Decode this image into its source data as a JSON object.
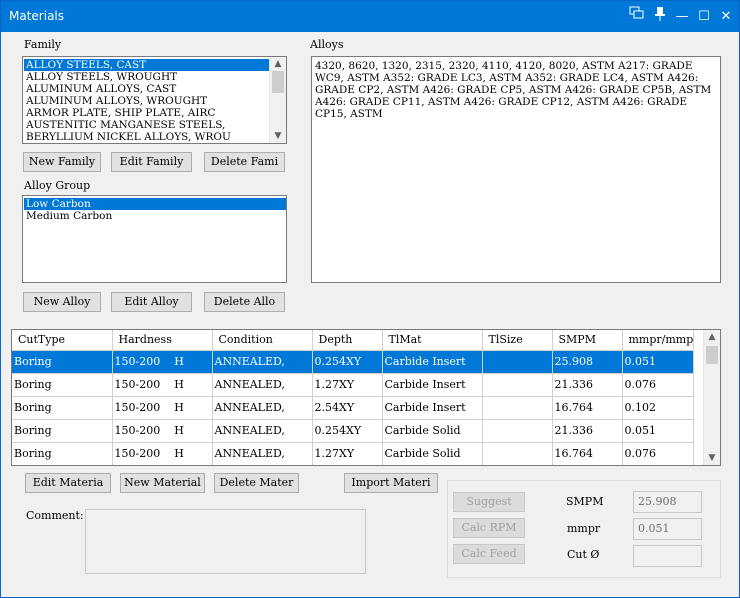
{
  "window": {
    "title": "Materials"
  },
  "family": {
    "label": "Family",
    "items": [
      {
        "label": "ALLOY STEELS, CAST",
        "selected": true
      },
      {
        "label": "ALLOY STEELS, WROUGHT",
        "selected": false
      },
      {
        "label": "ALUMINUM ALLOYS, CAST",
        "selected": false
      },
      {
        "label": "ALUMINUM ALLOYS, WROUGHT",
        "selected": false
      },
      {
        "label": "ARMOR PLATE, SHIP PLATE, AIRC",
        "selected": false
      },
      {
        "label": "AUSTENITIC MANGANESE STEELS,",
        "selected": false
      },
      {
        "label": "BERYLLIUM NICKEL ALLOYS, WROU",
        "selected": false
      }
    ],
    "buttons": {
      "new": "New Family",
      "edit": "Edit Family",
      "delete": "Delete Fami"
    }
  },
  "alloy_group": {
    "label": "Alloy Group",
    "items": [
      {
        "label": "Low Carbon",
        "selected": true
      },
      {
        "label": "Medium Carbon",
        "selected": false
      }
    ],
    "buttons": {
      "new": "New Alloy",
      "edit": "Edit Alloy",
      "delete": "Delete Allo"
    }
  },
  "alloys": {
    "label": "Alloys",
    "text": "4320, 8620, 1320, 2315, 2320, 4110, 4120, 8020, ASTM A217: GRADE WC9, ASTM A352: GRADE LC3, ASTM A352: GRADE LC4, ASTM A426: GRADE CP2, ASTM A426: GRADE CP5, ASTM A426: GRADE CP5B, ASTM A426: GRADE CP11, ASTM A426: GRADE CP12, ASTM A426: GRADE CP15, ASTM"
  },
  "grid": {
    "columns": [
      "CutType",
      "Hardness",
      "Condition",
      "Depth",
      "TlMat",
      "TlSize",
      "SMPM",
      "mmpr/mmpt"
    ],
    "rows": [
      {
        "cells": [
          "Boring",
          "150-200    H",
          "ANNEALED,",
          "0.254XY",
          "Carbide Insert",
          "",
          "25.908",
          "0.051"
        ],
        "selected": true
      },
      {
        "cells": [
          "Boring",
          "150-200    H",
          "ANNEALED,",
          "1.27XY",
          "Carbide Insert",
          "",
          "21.336",
          "0.076"
        ],
        "selected": false
      },
      {
        "cells": [
          "Boring",
          "150-200    H",
          "ANNEALED,",
          "2.54XY",
          "Carbide Insert",
          "",
          "16.764",
          "0.102"
        ],
        "selected": false
      },
      {
        "cells": [
          "Boring",
          "150-200    H",
          "ANNEALED,",
          "0.254XY",
          "Carbide Solid",
          "",
          "21.336",
          "0.051"
        ],
        "selected": false
      },
      {
        "cells": [
          "Boring",
          "150-200    H",
          "ANNEALED,",
          "1.27XY",
          "Carbide Solid",
          "",
          "16.764",
          "0.076"
        ],
        "selected": false
      }
    ]
  },
  "material_buttons": {
    "edit": "Edit Materia",
    "new": "New Material",
    "delete": "Delete Mater",
    "import": "Import Materi"
  },
  "comment": {
    "label": "Comment:"
  },
  "calc": {
    "suggest": "Suggest",
    "calc_rpm": "Calc RPM",
    "calc_feed": "Calc Feed",
    "smpm_label": "SMPM",
    "mmpr_label": "mmpr",
    "cut_label": "Cut Ø",
    "smpm_value": "25.908",
    "mmpr_value": "0.051",
    "cut_value": ""
  }
}
